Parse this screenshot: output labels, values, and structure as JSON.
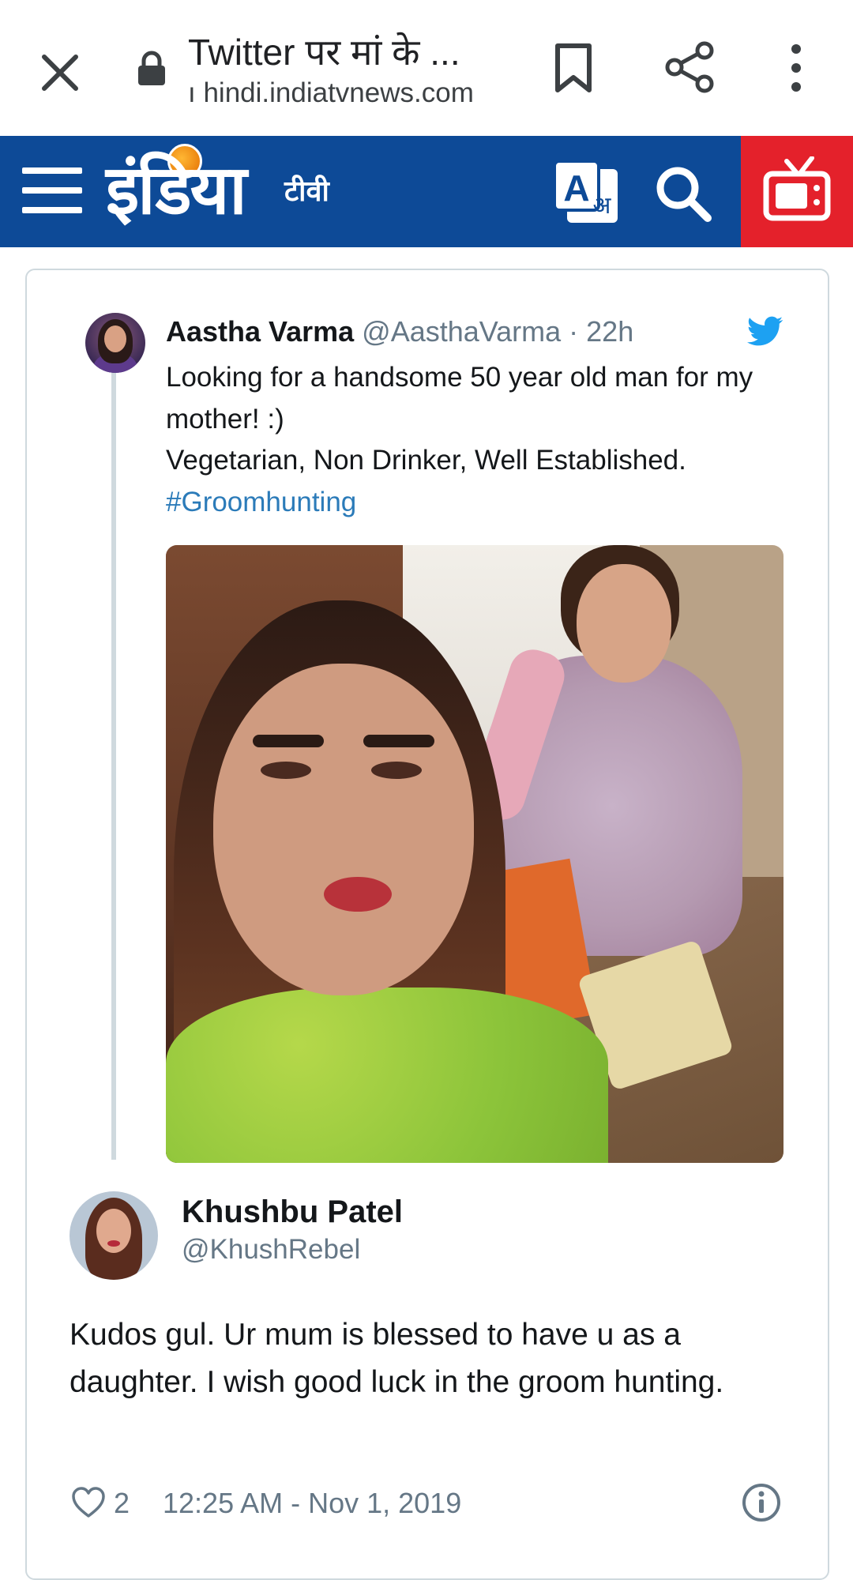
{
  "browser": {
    "page_title": "Twitter पर मां के ...",
    "url": "ı hindi.indiatvnews.com",
    "icons": [
      "close-icon",
      "lock-icon",
      "bookmark-icon",
      "share-icon",
      "more-vert-icon"
    ]
  },
  "site_header": {
    "logo_text": "इंडिया",
    "logo_suffix": "टीवी",
    "colors": {
      "header_bg": "#0d4a97",
      "live_tv_bg": "#e4212b"
    },
    "icons": [
      "menu-icon",
      "translate-icon",
      "search-icon",
      "live-tv-icon"
    ]
  },
  "tweet": {
    "author_name": "Aastha Varma",
    "author_handle": "@AasthaVarma",
    "time": "· 22h",
    "text": "Looking for a handsome 50 year old man for my mother! :)\nVegetarian, Non Drinker, Well Established.",
    "hashtag": "#Groomhunting",
    "colors": {
      "link": "#2b7bb9",
      "twitter_blue": "#1da1f2"
    }
  },
  "reply": {
    "author_name": "Khushbu Patel",
    "author_handle": "@KhushRebel",
    "text": "Kudos gul. Ur mum is blessed to have u as a daughter. I wish good luck in the groom hunting.",
    "likes": "2",
    "timestamp": "12:25 AM - Nov 1, 2019"
  }
}
